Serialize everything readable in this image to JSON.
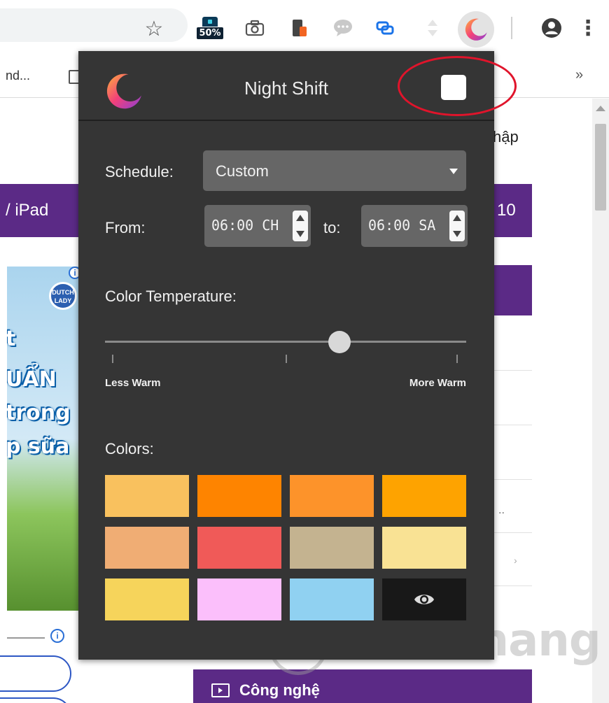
{
  "toolbar": {
    "zoom_badge": "50%",
    "star_glyph": "☆",
    "menu_glyph": "⋮"
  },
  "bookmarks": {
    "item_text": "nd...",
    "more_glyph": "»"
  },
  "background_page": {
    "right_heading": "hập",
    "left_banner": "/ iPad",
    "right_banner": "10",
    "ad_logo_text": "DUTCH LADY",
    "ad_info": "i",
    "ad_lines": [
      "t",
      "UẨN",
      "trong",
      "p sữa"
    ],
    "ellipsis": "..",
    "chevron": "›",
    "info_icon": "i",
    "tech_button_label": "Công nghệ",
    "watermark_text": "uantrimang"
  },
  "popup": {
    "title": "Night Shift",
    "schedule_label": "Schedule:",
    "schedule_value": "Custom",
    "from_label": "From:",
    "from_value": "06:00 CH",
    "to_label": "to:",
    "to_value": "06:00 SA",
    "color_temp_label": "Color Temperature:",
    "color_temp_level": 0.65,
    "less_warm_label": "Less Warm",
    "more_warm_label": "More Warm",
    "colors_label": "Colors:",
    "swatches": [
      {
        "color": "#f9c15e",
        "icon": null
      },
      {
        "color": "#fe8400",
        "icon": null
      },
      {
        "color": "#fd932a",
        "icon": null
      },
      {
        "color": "#fea300",
        "icon": null
      },
      {
        "color": "#f0ad74",
        "icon": null
      },
      {
        "color": "#f05a58",
        "icon": null
      },
      {
        "color": "#c4b390",
        "icon": null
      },
      {
        "color": "#f9e294",
        "icon": null
      },
      {
        "color": "#f6d45b",
        "icon": null
      },
      {
        "color": "#fbbffb",
        "icon": null
      },
      {
        "color": "#90d1f1",
        "icon": null
      },
      {
        "color": "#181818",
        "icon": "eye-icon"
      }
    ]
  },
  "colors": {
    "accent_purple": "#5b2a86",
    "popup_bg": "#353535",
    "control_bg": "#666666",
    "highlight_red": "#e0142b"
  }
}
